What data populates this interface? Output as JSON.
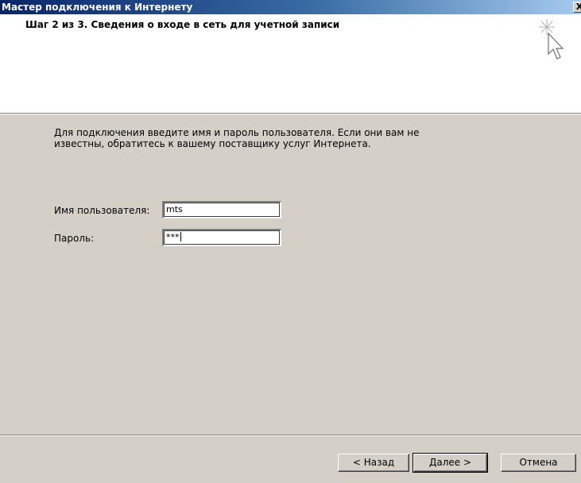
{
  "window": {
    "title": "Мастер подключения к Интернету",
    "close_label": "X"
  },
  "header": {
    "step_title": "Шаг 2 из 3. Сведения о входе в сеть для учетной записи",
    "icon": "wizard-cursor-sparkle-icon"
  },
  "content": {
    "instruction_line1": "Для подключения введите имя и пароль пользователя. Если они вам не",
    "instruction_line2": "известны, обратитесь к вашему поставщику услуг Интернета.",
    "username_label": "Имя пользователя:",
    "username_value": "mts",
    "password_label": "Пароль:",
    "password_value": "***"
  },
  "buttons": {
    "back": "< Назад",
    "next": "Далее >",
    "cancel": "Отмена"
  }
}
